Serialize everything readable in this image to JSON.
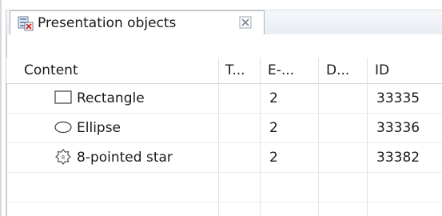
{
  "tab": {
    "label": "Presentation objects",
    "icon": "presentation-objects-icon",
    "close_icon": "close-icon"
  },
  "table": {
    "columns": [
      {
        "key": "content",
        "label": "Content"
      },
      {
        "key": "t",
        "label": "T..."
      },
      {
        "key": "e",
        "label": "E-..."
      },
      {
        "key": "d",
        "label": "D..."
      },
      {
        "key": "id",
        "label": "ID"
      }
    ],
    "rows": [
      {
        "icon": "rectangle-icon",
        "content": "Rectangle",
        "t": "",
        "e": "2",
        "d": "",
        "id": "33335"
      },
      {
        "icon": "ellipse-icon",
        "content": "Ellipse",
        "t": "",
        "e": "2",
        "d": "",
        "id": "33336"
      },
      {
        "icon": "star-icon",
        "content": "8-pointed star",
        "t": "",
        "e": "2",
        "d": "",
        "id": "33382"
      }
    ]
  }
}
